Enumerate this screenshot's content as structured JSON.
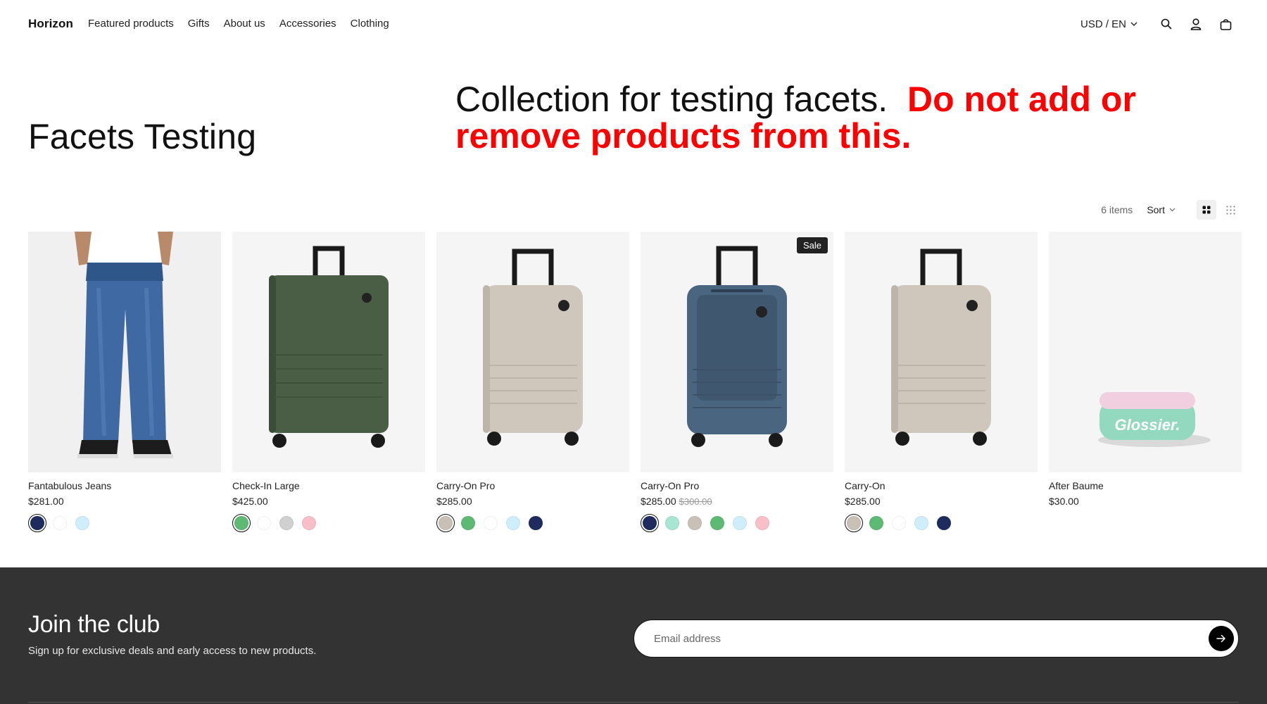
{
  "header": {
    "logo": "Horizon",
    "nav": [
      "Featured products",
      "Gifts",
      "About us",
      "Accessories",
      "Clothing"
    ],
    "locale": "USD / EN",
    "icons": [
      "search-icon",
      "account-icon",
      "cart-icon"
    ]
  },
  "hero": {
    "title": "Facets Testing",
    "description_plain": "Collection for testing facets.",
    "description_warning": "Do not add or remove products from this.",
    "warning_color": "#ff0000"
  },
  "toolbar": {
    "count": "6 items",
    "sort_label": "Sort",
    "views": [
      "grid-large-icon",
      "grid-small-icon"
    ]
  },
  "products": [
    {
      "name": "Fantabulous Jeans",
      "price": "$281.00",
      "compare_price": "",
      "badge": "",
      "image": "jeans",
      "swatches": [
        {
          "color": "#1d2b5e",
          "selected": true
        },
        {
          "color": "#ffffff",
          "selected": false
        },
        {
          "color": "#cfeefc",
          "selected": false
        }
      ]
    },
    {
      "name": "Check-In Large",
      "price": "$425.00",
      "compare_price": "",
      "badge": "",
      "image": "suitcase-green",
      "swatches": [
        {
          "color": "#5cba73",
          "selected": true
        },
        {
          "color": "#ffffff",
          "selected": false
        },
        {
          "color": "#d0d0d0",
          "selected": false
        },
        {
          "color": "#f8bfc9",
          "selected": false
        }
      ]
    },
    {
      "name": "Carry-On Pro",
      "price": "$285.00",
      "compare_price": "",
      "badge": "",
      "image": "suitcase-sand",
      "swatches": [
        {
          "color": "#c9c1b5",
          "selected": true
        },
        {
          "color": "#5cba73",
          "selected": false
        },
        {
          "color": "#ffffff",
          "selected": false
        },
        {
          "color": "#cfeefc",
          "selected": false
        },
        {
          "color": "#1d2b5e",
          "selected": false
        }
      ]
    },
    {
      "name": "Carry-On Pro",
      "price": "$285.00",
      "compare_price": "$300.00",
      "badge": "Sale",
      "image": "suitcase-blue",
      "swatches": [
        {
          "color": "#1d2b5e",
          "selected": true
        },
        {
          "color": "#a6e6d3",
          "selected": false
        },
        {
          "color": "#c9c1b5",
          "selected": false
        },
        {
          "color": "#5cba73",
          "selected": false
        },
        {
          "color": "#cfeefc",
          "selected": false
        },
        {
          "color": "#f8bfc9",
          "selected": false
        }
      ]
    },
    {
      "name": "Carry-On",
      "price": "$285.00",
      "compare_price": "",
      "badge": "",
      "image": "suitcase-sand",
      "swatches": [
        {
          "color": "#c9c1b5",
          "selected": true
        },
        {
          "color": "#5cba73",
          "selected": false
        },
        {
          "color": "#ffffff",
          "selected": false
        },
        {
          "color": "#cfeefc",
          "selected": false
        },
        {
          "color": "#1d2b5e",
          "selected": false
        }
      ]
    },
    {
      "name": "After Baume",
      "price": "$30.00",
      "compare_price": "",
      "badge": "",
      "image": "balm-jar",
      "image_text": "Glossier.",
      "swatches": []
    }
  ],
  "footer": {
    "title": "Join the club",
    "subtitle": "Sign up for exclusive deals and early access to new products.",
    "email_placeholder": "Email address",
    "icons": [
      "arrow-right-icon"
    ]
  }
}
